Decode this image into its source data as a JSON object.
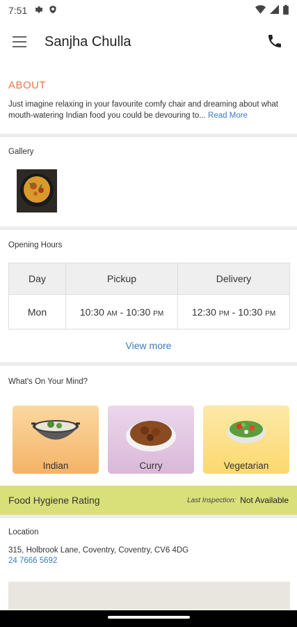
{
  "status_bar": {
    "time": "7:51"
  },
  "app_bar": {
    "title": "Sanjha Chulla"
  },
  "about": {
    "title": "ABOUT",
    "text": "Just imagine relaxing in your favourite comfy chair and dreaming about what mouth-watering Indian food you could be devouring to",
    "ellipsis": "... ",
    "read_more": "Read More"
  },
  "gallery": {
    "label": "Gallery"
  },
  "opening_hours": {
    "label": "Opening Hours",
    "columns": [
      "Day",
      "Pickup",
      "Delivery"
    ],
    "rows": [
      {
        "day": "Mon",
        "pickup_open": "10:30",
        "pickup_open_ampm": "AM",
        "pickup_close": "10:30",
        "pickup_close_ampm": "PM",
        "delivery_open": "12:30",
        "delivery_open_ampm": "PM",
        "delivery_close": "10:30",
        "delivery_close_ampm": "PM"
      }
    ],
    "view_more": "View more"
  },
  "whats_on_mind": {
    "label": "What's On Your Mind?",
    "cards": [
      {
        "name": "Indian",
        "color": "#f6c27f"
      },
      {
        "name": "Curry",
        "color": "#e2c6e0"
      },
      {
        "name": "Vegetarian",
        "color": "#fbe08a"
      }
    ]
  },
  "hygiene": {
    "title": "Food Hygiene Rating",
    "last_inspection_label": "Last Inspection:",
    "value": "Not Available"
  },
  "location": {
    "label": "Location",
    "address": "315, Holbrook Lane, Coventry, Coventry, CV6 4DG",
    "phone": "24 7666 5692"
  }
}
